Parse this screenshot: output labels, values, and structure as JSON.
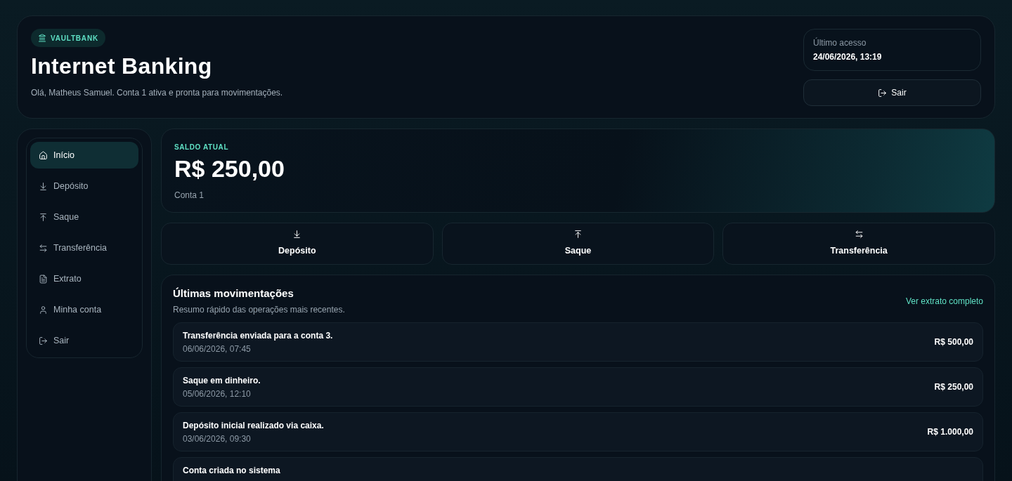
{
  "brand": {
    "label": "VAULTBANK"
  },
  "header": {
    "title": "Internet Banking",
    "subtitle": "Olá, Matheus Samuel. Conta 1 ativa e pronta para movimentações."
  },
  "last_access": {
    "label": "Último acesso",
    "value": "24/06/2026, 13:19"
  },
  "logout_button": {
    "label": "Sair"
  },
  "sidebar": {
    "items": [
      {
        "kind": "home",
        "label": "Início",
        "selected": true
      },
      {
        "kind": "deposit",
        "label": "Depósito",
        "selected": false
      },
      {
        "kind": "withdraw",
        "label": "Saque",
        "selected": false
      },
      {
        "kind": "transfer",
        "label": "Transferência",
        "selected": false
      },
      {
        "kind": "statement",
        "label": "Extrato",
        "selected": false
      },
      {
        "kind": "account",
        "label": "Minha conta",
        "selected": false
      },
      {
        "kind": "logout",
        "label": "Sair",
        "selected": false
      }
    ]
  },
  "balance": {
    "label": "SALDO ATUAL",
    "amount": "R$ 250,00",
    "account": "Conta 1"
  },
  "actions": [
    {
      "kind": "deposit",
      "label": "Depósito"
    },
    {
      "kind": "withdraw",
      "label": "Saque"
    },
    {
      "kind": "transfer",
      "label": "Transferência"
    }
  ],
  "movements": {
    "title": "Últimas movimentações",
    "subtitle": "Resumo rápido das operações mais recentes.",
    "link": "Ver extrato completo",
    "items": [
      {
        "description": "Transferência enviada para a conta 3.",
        "date": "06/06/2026, 07:45",
        "amount": "R$ 500,00"
      },
      {
        "description": "Saque em dinheiro.",
        "date": "05/06/2026, 12:10",
        "amount": "R$ 250,00"
      },
      {
        "description": "Depósito inicial realizado via caixa.",
        "date": "03/06/2026, 09:30",
        "amount": "R$ 1.000,00"
      },
      {
        "description": "Conta criada no sistema"
      }
    ]
  }
}
